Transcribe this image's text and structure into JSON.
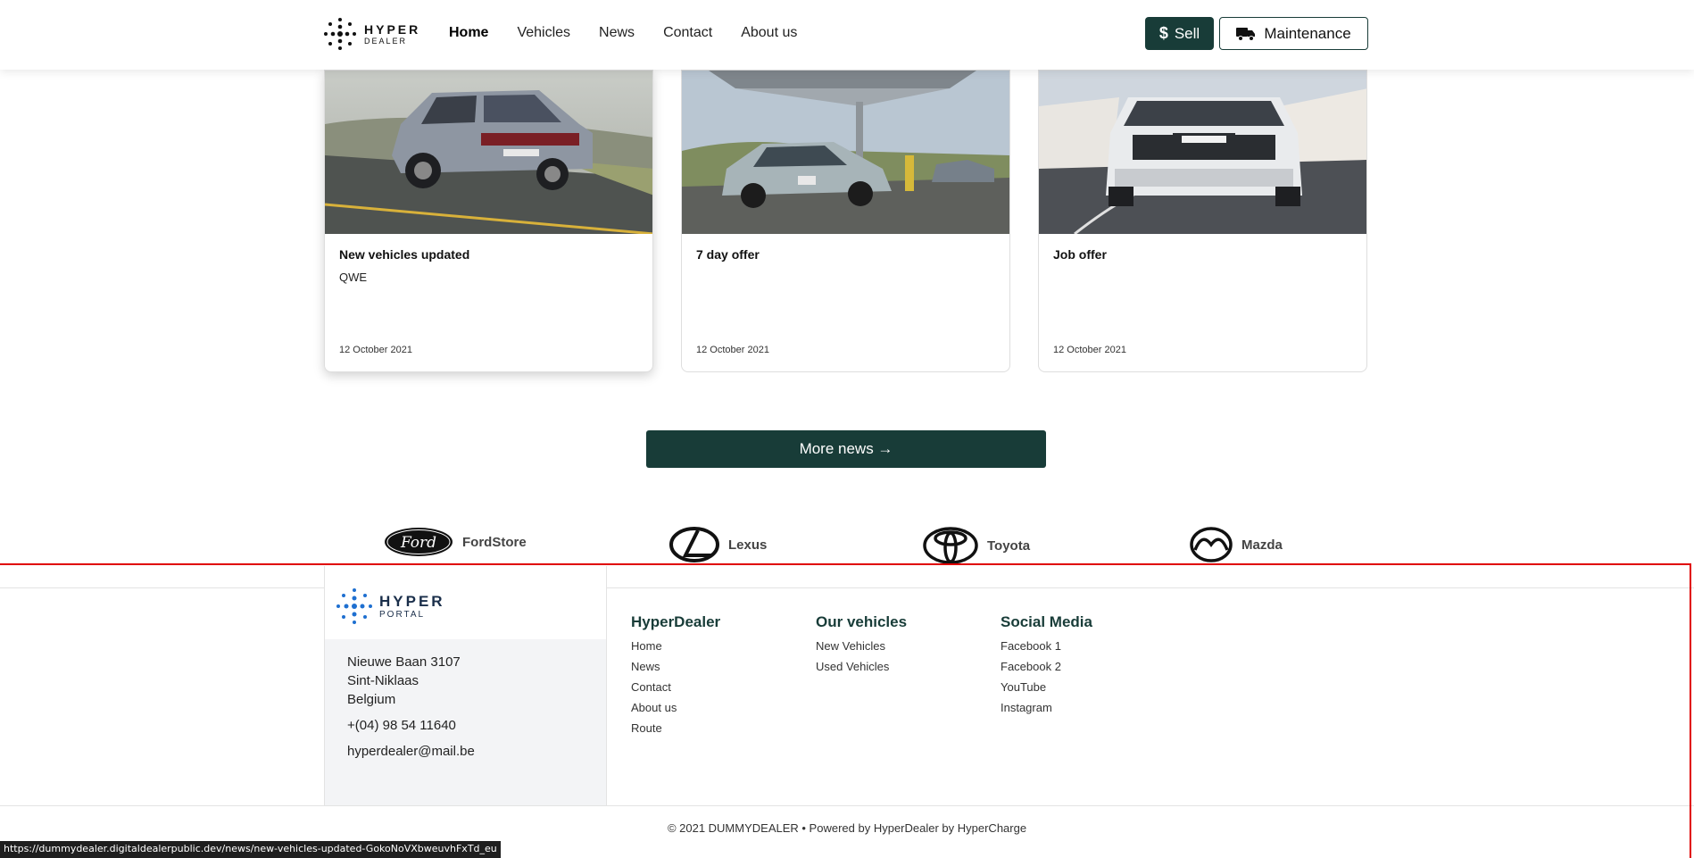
{
  "header": {
    "logo": {
      "line1": "HYPER",
      "line2": "DEALER"
    },
    "nav": [
      {
        "label": "Home",
        "active": true
      },
      {
        "label": "Vehicles",
        "active": false
      },
      {
        "label": "News",
        "active": false
      },
      {
        "label": "Contact",
        "active": false
      },
      {
        "label": "About us",
        "active": false
      }
    ],
    "sell_label": "Sell",
    "maintenance_label": "Maintenance"
  },
  "news": [
    {
      "title": "New vehicles updated",
      "subtitle": "QWE",
      "date": "12 October 2021"
    },
    {
      "title": "7 day offer",
      "subtitle": "",
      "date": "12 October 2021"
    },
    {
      "title": "Job offer",
      "subtitle": "",
      "date": "12 October 2021"
    }
  ],
  "more_news_label": "More news →",
  "brands": [
    {
      "name": "FordStore",
      "logo_text": "Ford"
    },
    {
      "name": "Lexus"
    },
    {
      "name": "Toyota"
    },
    {
      "name": "Mazda"
    }
  ],
  "footer": {
    "portal_logo": {
      "line1": "HYPER",
      "line2": "PORTAL"
    },
    "address": [
      "Nieuwe Baan 3107",
      "Sint-Niklaas",
      "Belgium"
    ],
    "phone": "+(04) 98 54 11640",
    "email": "hyperdealer@mail.be",
    "columns": [
      {
        "heading": "HyperDealer",
        "links": [
          "Home",
          "News",
          "Contact",
          "About us",
          "Route"
        ]
      },
      {
        "heading": "Our vehicles",
        "links": [
          "New Vehicles",
          "Used Vehicles"
        ]
      },
      {
        "heading": "Social Media",
        "links": [
          "Facebook 1",
          "Facebook 2",
          "YouTube",
          "Instagram"
        ]
      }
    ],
    "copyright": "© 2021 DUMMYDEALER • Powered by HyperDealer by HyperCharge"
  },
  "status_url": "https://dummydealer.digitaldealerpublic.dev/news/new-vehicles-updated-GokoNoVXbweuvhFxTd_eu",
  "colors": {
    "primary": "#183c38",
    "highlight": "#e00000"
  }
}
